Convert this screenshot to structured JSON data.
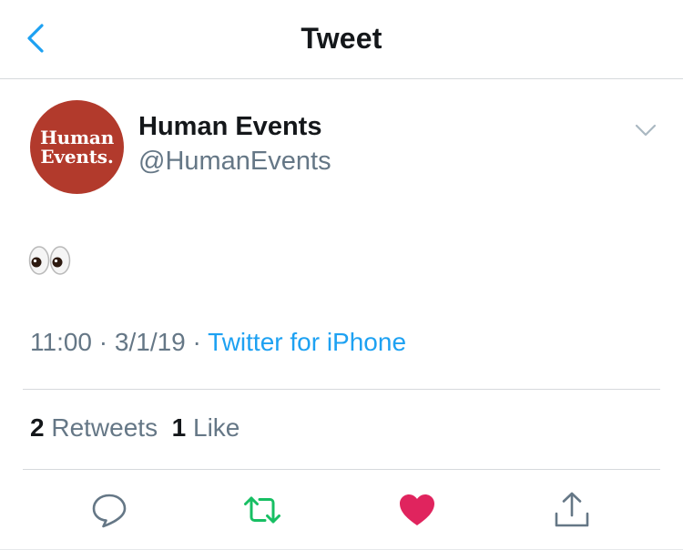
{
  "nav": {
    "title": "Tweet",
    "back_icon": "chevron-left-icon"
  },
  "tweet": {
    "author": {
      "name": "Human Events",
      "handle": "@HumanEvents",
      "avatar_line1": "Human",
      "avatar_line2": "Events.",
      "avatar_color": "#b23a2c"
    },
    "text_emoji": "eyes-emoji",
    "time": "11:00",
    "sep1": " · ",
    "date": "3/1/19",
    "sep2": " · ",
    "source": "Twitter for iPhone",
    "retweets_count": "2",
    "retweets_label": "Retweets",
    "likes_count": "1",
    "likes_label": "Like"
  },
  "actions": [
    {
      "icon": "reply-icon"
    },
    {
      "icon": "retweet-icon",
      "color": "#17bf63"
    },
    {
      "icon": "heart-icon",
      "color": "#e0245e"
    },
    {
      "icon": "share-icon"
    }
  ],
  "colors": {
    "accent": "#1da1f2",
    "text": "#14171a",
    "secondary": "#657786"
  }
}
